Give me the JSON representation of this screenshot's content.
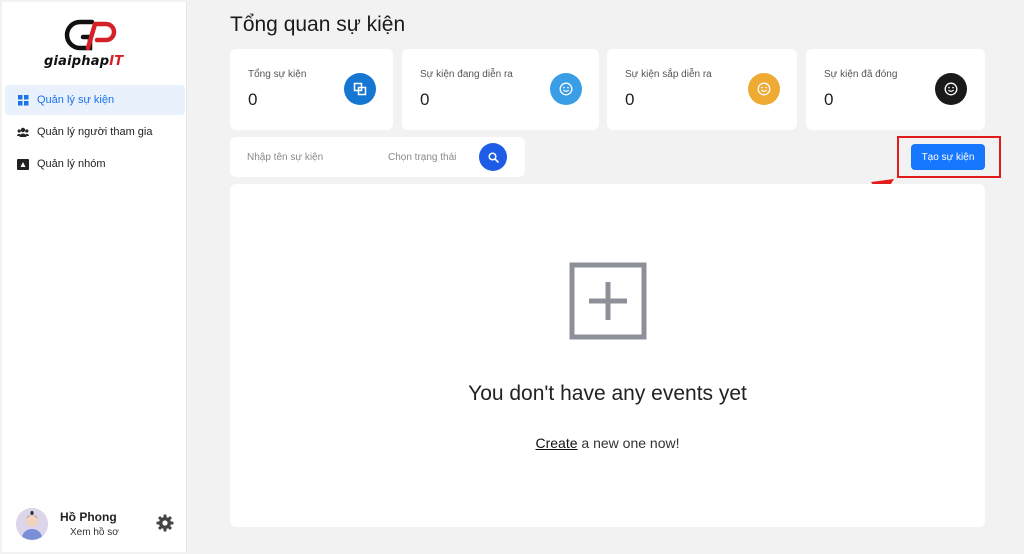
{
  "sidebar": {
    "logo": {
      "name": "giaiphap",
      "suffix": "IT"
    },
    "items": [
      {
        "label": "Quản lý sự kiện",
        "icon": "grid-icon",
        "active": true
      },
      {
        "label": "Quản lý người tham gia",
        "icon": "users-icon",
        "active": false
      },
      {
        "label": "Quản lý nhóm",
        "icon": "group-card-icon",
        "active": false
      }
    ],
    "profile": {
      "name": "Hồ Phong",
      "link": "Xem hồ sơ"
    }
  },
  "main": {
    "title": "Tổng quan sự kiện",
    "stats": [
      {
        "label": "Tổng sự kiện",
        "value": "0",
        "icon": "copy-squares-icon",
        "color": "#1677d2"
      },
      {
        "label": "Sự kiện đang diễn ra",
        "value": "0",
        "icon": "smile-icon",
        "color": "#3a9ee6"
      },
      {
        "label": "Sự kiện sắp diễn ra",
        "value": "0",
        "icon": "smile-icon",
        "color": "#eeaa33"
      },
      {
        "label": "Sự kiện đã đóng",
        "value": "0",
        "icon": "smile-icon",
        "color": "#1a1a1a"
      }
    ],
    "filter": {
      "name_placeholder": "Nhập tên sự kiện",
      "status_placeholder": "Chọn trạng thái"
    },
    "create_button": "Tạo sự kiện",
    "empty": {
      "title": "You don't have any events yet",
      "link": "Create",
      "rest": " a new one now!"
    }
  },
  "colors": {
    "primary": "#1677ff",
    "search": "#1e5be6",
    "annotation": "#e21b1b"
  }
}
